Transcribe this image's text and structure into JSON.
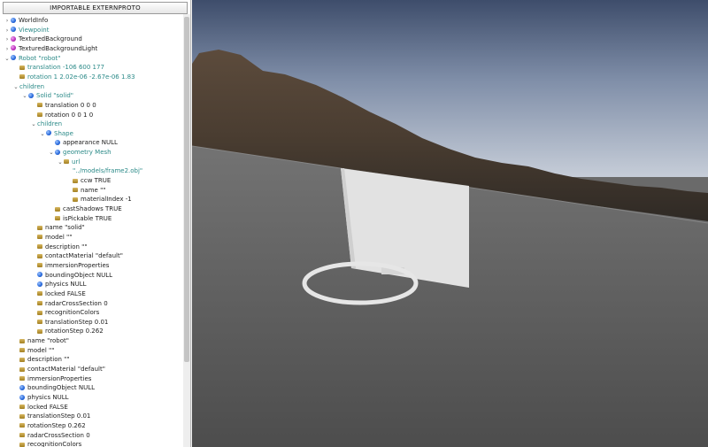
{
  "toolbar": {
    "proto_button": "IMPORTABLE EXTERNPROTO"
  },
  "tree": [
    {
      "arrow": "›",
      "icon": "sphere-blue",
      "label": "WorldInfo"
    },
    {
      "arrow": "›",
      "icon": "sphere-blue",
      "label": "Viewpoint",
      "teal": true
    },
    {
      "arrow": "›",
      "icon": "sphere-magenta",
      "label": "TexturedBackground"
    },
    {
      "arrow": "›",
      "icon": "sphere-magenta",
      "label": "TexturedBackgroundLight"
    },
    {
      "arrow": "⌄",
      "icon": "sphere-blue",
      "label": "Robot \"robot\"",
      "teal": true
    },
    {
      "icon": "field-gold",
      "label": "translation -106 600 177",
      "teal": true
    },
    {
      "icon": "field-gold",
      "label": "rotation 1 2.02e-06 -2.67e-06 1.83",
      "teal": true
    },
    {
      "arrow": "⌄",
      "label": "children",
      "teal": true
    },
    {
      "arrow": "⌄",
      "icon": "sphere-blue",
      "label": "Solid \"solid\"",
      "teal": true
    },
    {
      "icon": "field-gold",
      "label": "translation 0 0 0"
    },
    {
      "icon": "field-gold",
      "label": "rotation 0 0 1 0"
    },
    {
      "arrow": "⌄",
      "label": "children",
      "teal": true
    },
    {
      "arrow": "⌄",
      "icon": "sphere-blue",
      "label": "Shape",
      "teal": true
    },
    {
      "icon": "sphere-blue",
      "label": "appearance NULL"
    },
    {
      "arrow": "⌄",
      "icon": "sphere-blue",
      "label": "geometry Mesh",
      "teal": true
    },
    {
      "arrow": "⌄",
      "icon": "field-gold",
      "label": "url",
      "teal": true
    },
    {
      "label": "\"../models/frame2.obj\"",
      "teal": true
    },
    {
      "icon": "field-gold",
      "label": "ccw TRUE"
    },
    {
      "icon": "field-gold",
      "label": "name \"\""
    },
    {
      "icon": "field-gold",
      "label": "materialIndex -1"
    },
    {
      "icon": "field-gold",
      "label": "castShadows TRUE"
    },
    {
      "icon": "field-gold",
      "label": "isPickable TRUE"
    },
    {
      "icon": "field-gold",
      "label": "name \"solid\""
    },
    {
      "icon": "field-gold",
      "label": "model \"\""
    },
    {
      "icon": "field-gold",
      "label": "description \"\""
    },
    {
      "icon": "field-gold",
      "label": "contactMaterial \"default\""
    },
    {
      "icon": "field-gold",
      "label": "immersionProperties"
    },
    {
      "icon": "sphere-blue",
      "label": "boundingObject NULL"
    },
    {
      "icon": "sphere-blue",
      "label": "physics NULL"
    },
    {
      "icon": "field-gold",
      "label": "locked FALSE"
    },
    {
      "icon": "field-gold",
      "label": "radarCrossSection 0"
    },
    {
      "icon": "field-gold",
      "label": "recognitionColors"
    },
    {
      "icon": "field-gold",
      "label": "translationStep 0.01"
    },
    {
      "icon": "field-gold",
      "label": "rotationStep 0.262"
    },
    {
      "icon": "field-gold",
      "label": "name \"robot\""
    },
    {
      "icon": "field-gold",
      "label": "model \"\""
    },
    {
      "icon": "field-gold",
      "label": "description \"\""
    },
    {
      "icon": "field-gold",
      "label": "contactMaterial \"default\""
    },
    {
      "icon": "field-gold",
      "label": "immersionProperties"
    },
    {
      "icon": "sphere-blue",
      "label": "boundingObject NULL"
    },
    {
      "icon": "sphere-blue",
      "label": "physics NULL"
    },
    {
      "icon": "field-gold",
      "label": "locked FALSE"
    },
    {
      "icon": "field-gold",
      "label": "translationStep 0.01"
    },
    {
      "icon": "field-gold",
      "label": "rotationStep 0.262"
    },
    {
      "icon": "field-gold",
      "label": "radarCrossSection 0"
    },
    {
      "icon": "field-gold",
      "label": "recognitionColors"
    }
  ],
  "colors": {
    "teal_text": "#2b8a88",
    "field_icon": "#b08a2e",
    "node_icon": "#1c5fd6",
    "bg_node_icon": "#b521b5"
  }
}
